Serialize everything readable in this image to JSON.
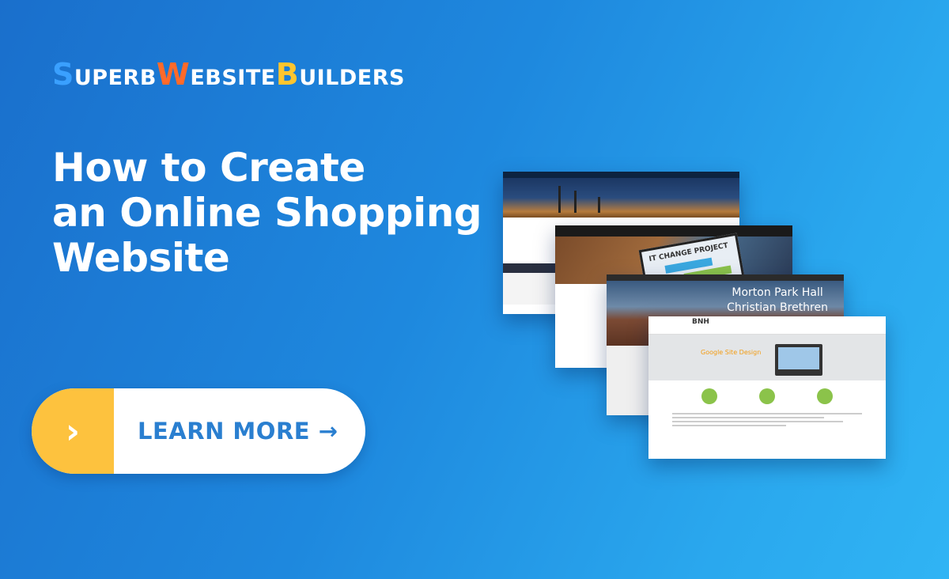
{
  "logo": {
    "s_cap": "S",
    "s_rest": "UPERB",
    "w_cap": "W",
    "w_rest": "EBSITE",
    "b_cap": "B",
    "b_rest": "UILDERS"
  },
  "headline": {
    "line1": "How to Create",
    "line2": "an Online Shopping",
    "line3": "Website"
  },
  "cta": {
    "icon": "›",
    "label": "LEARN MORE →"
  },
  "screenshots": {
    "s2_tablet_text": "IT CHANGE PROJECT",
    "s3_title_line1": "Morton Park Hall",
    "s3_title_line2": "Christian Brethren",
    "s4_brand": "BNH",
    "s4_hero_title": "Google Site Design"
  },
  "colors": {
    "background_start": "#1a6fcc",
    "background_end": "#30b4f4",
    "logo_s": "#3aa0ff",
    "logo_w": "#ff6a2a",
    "logo_b": "#ffc52e",
    "cta_accent": "#fdc23e",
    "cta_text": "#2a7fd0"
  }
}
